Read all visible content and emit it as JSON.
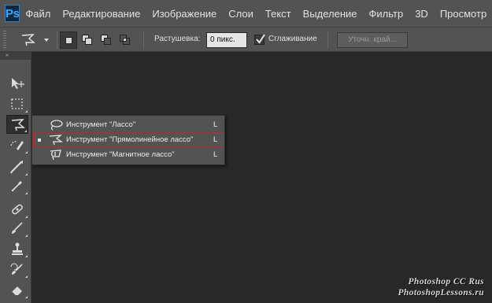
{
  "app": {
    "logo": "Ps"
  },
  "menu": [
    "Файл",
    "Редактирование",
    "Изображение",
    "Слои",
    "Текст",
    "Выделение",
    "Фильтр",
    "3D",
    "Просмотр"
  ],
  "options": {
    "feather_label": "Растушевка:",
    "feather_value": "0 пикс.",
    "antialias_label": "Сглаживание",
    "antialias_checked": true,
    "refine_edge": "Уточн. край..."
  },
  "tools_panel": {
    "collapse_glyph": "»"
  },
  "flyout": {
    "items": [
      {
        "label": "Инструмент \"Лассо\"",
        "shortcut": "L",
        "icon": "lasso-icon",
        "selected": false
      },
      {
        "label": "Инструмент \"Прямолинейное лассо\"",
        "shortcut": "L",
        "icon": "polygonal-lasso-icon",
        "selected": true
      },
      {
        "label": "Инструмент \"Магнитное лассо\"",
        "shortcut": "L",
        "icon": "magnetic-lasso-icon",
        "selected": false
      }
    ]
  },
  "watermark": {
    "line1": "Photoshop  CC  Rus",
    "line2": "PhotoshopLessons.ru"
  },
  "colors": {
    "chrome": "#535353",
    "canvas": "#282828",
    "highlight": "#c8232b",
    "logo_accent": "#38a8ff"
  }
}
